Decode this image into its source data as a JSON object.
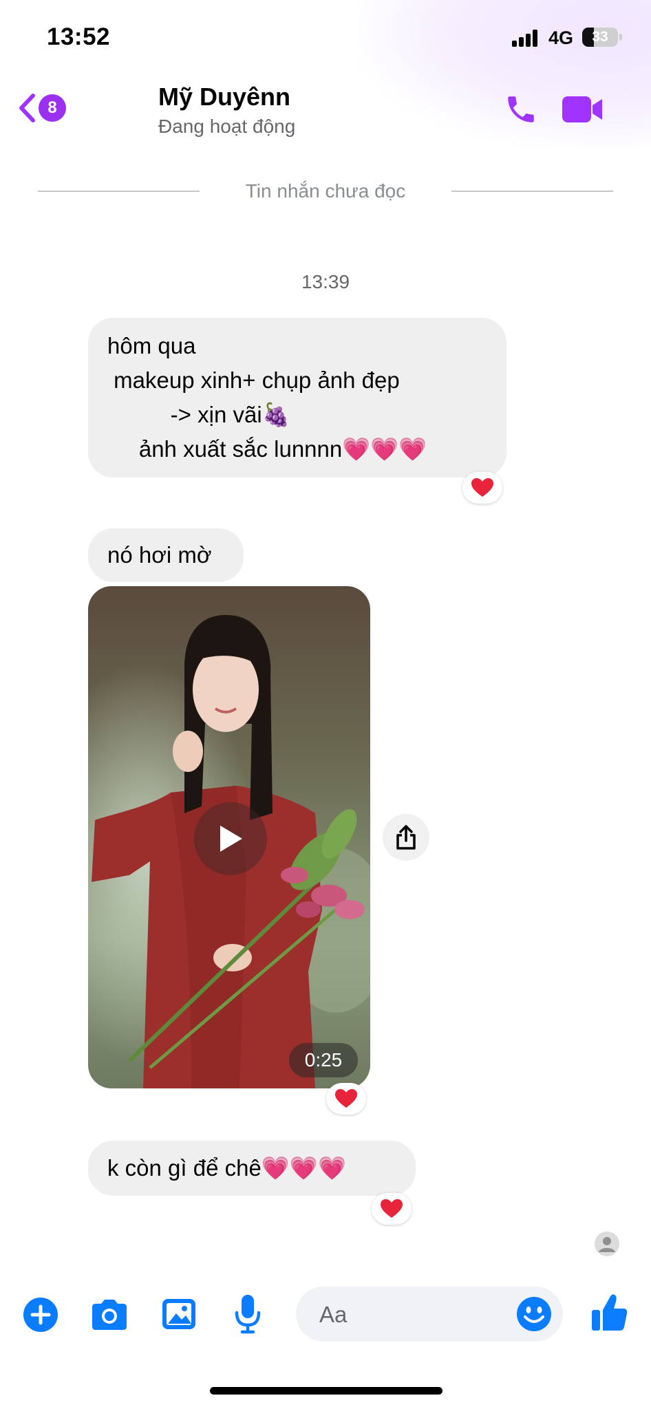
{
  "status_bar": {
    "time": "13:52",
    "network": "4G",
    "battery": "33",
    "battery_level": 0.33
  },
  "header": {
    "back_badge": "8",
    "contact_name": "Mỹ Duyênn",
    "presence": "Đang hoạt động",
    "icons": [
      "back-chevron-icon",
      "phone-icon",
      "video-camera-icon"
    ]
  },
  "thread": {
    "unread_divider": "Tin nhắn chưa đọc",
    "timestamp": "13:39",
    "messages": [
      {
        "lines": [
          "hôm qua",
          " makeup xinh+ chụp ảnh đẹp",
          "          -> xịn vãi🍇",
          "     ảnh xuất sắc lunnnn💗💗💗"
        ],
        "reaction": "❤️"
      },
      {
        "text": "nó hơi mờ"
      },
      {
        "type": "video",
        "duration": "0:25",
        "reaction": "❤️"
      },
      {
        "text": "k còn gì để chê💗💗💗",
        "reaction": "❤️"
      }
    ]
  },
  "composer": {
    "placeholder": "Aa",
    "icons": [
      "add-circle-icon",
      "camera-icon",
      "gallery-icon",
      "microphone-icon",
      "emoji-icon",
      "thumbs-up-icon"
    ]
  },
  "colors": {
    "accent": "#a033ff",
    "composer_icons": "#0a7cff",
    "bubble": "#efefef",
    "reaction_heart": "#e8243b"
  }
}
